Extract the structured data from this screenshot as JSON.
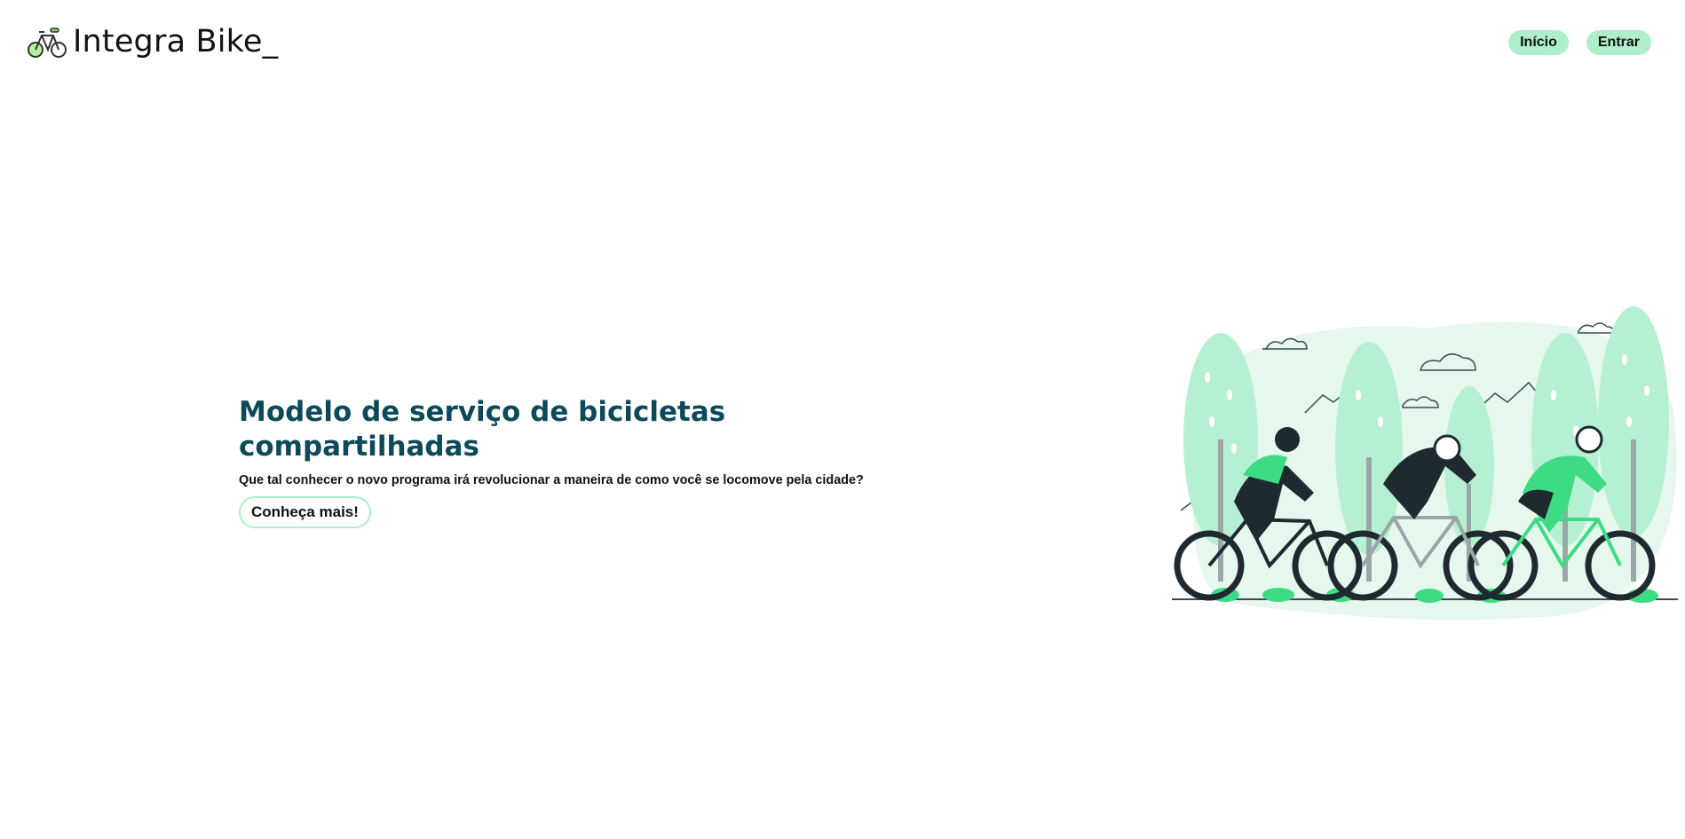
{
  "header": {
    "brand_name": "Integra Bike_",
    "brand_icon": "bicycle-icon",
    "nav": [
      {
        "label": "Início"
      },
      {
        "label": "Entrar"
      }
    ]
  },
  "hero": {
    "title": "Modelo de serviço de bicicletas compartilhadas",
    "subtitle": "Que tal conhecer o novo programa irá revolucionar a maneira de como você se locomove pela cidade?",
    "cta_label": "Conheça mais!"
  },
  "illustration": {
    "name": "cyclists-illustration"
  },
  "colors": {
    "accent": "#aeefc9",
    "title": "#0c4a5a",
    "illustration_green": "#3ddc84",
    "illustration_light": "#b6f0d2",
    "dark": "#1f2a30"
  }
}
